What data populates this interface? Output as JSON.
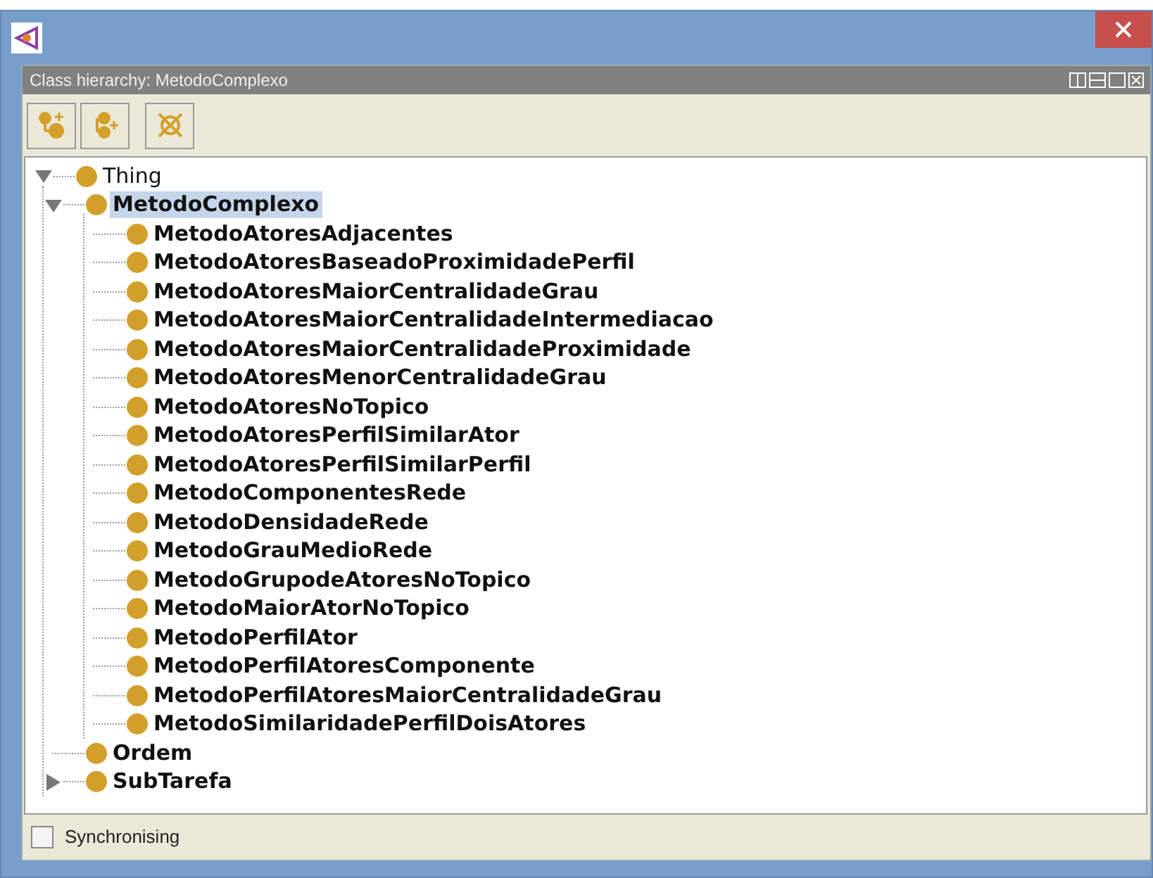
{
  "window": {
    "title": "Class hierarchy: MetodoComplexo"
  },
  "tree": [
    {
      "label": "Thing",
      "expanded": true,
      "selected": false,
      "children": [
        {
          "label": "MetodoComplexo",
          "expanded": true,
          "selected": true,
          "children": [
            {
              "label": "MetodoAtoresAdjacentes",
              "selected": false
            },
            {
              "label": "MetodoAtoresBaseadoProximidadePerfil",
              "selected": false
            },
            {
              "label": "MetodoAtoresMaiorCentralidadeGrau",
              "selected": false
            },
            {
              "label": "MetodoAtoresMaiorCentralidadeIntermediacao",
              "selected": false
            },
            {
              "label": "MetodoAtoresMaiorCentralidadeProximidade",
              "selected": false
            },
            {
              "label": "MetodoAtoresMenorCentralidadeGrau",
              "selected": false
            },
            {
              "label": "MetodoAtoresNoTopico",
              "selected": false
            },
            {
              "label": "MetodoAtoresPerfilSimilarAtor",
              "selected": false
            },
            {
              "label": "MetodoAtoresPerfilSimilarPerfil",
              "selected": false
            },
            {
              "label": "MetodoComponentesRede",
              "selected": false
            },
            {
              "label": "MetodoDensidadeRede",
              "selected": false
            },
            {
              "label": "MetodoGrauMedioRede",
              "selected": false
            },
            {
              "label": "MetodoGrupodeAtoresNoTopico",
              "selected": false
            },
            {
              "label": "MetodoMaiorAtorNoTopico",
              "selected": false
            },
            {
              "label": "MetodoPerfilAtor",
              "selected": false
            },
            {
              "label": "MetodoPerfilAtoresComponente",
              "selected": false
            },
            {
              "label": "MetodoPerfilAtoresMaiorCentralidadeGrau",
              "selected": false
            },
            {
              "label": "MetodoSimilaridadePerfilDoisAtores",
              "selected": false
            }
          ]
        },
        {
          "label": "Ordem",
          "selected": false
        },
        {
          "label": "SubTarefa",
          "expanded": false,
          "selected": false
        }
      ]
    }
  ],
  "synchronising": {
    "label": "Synchronising",
    "checked": false
  }
}
